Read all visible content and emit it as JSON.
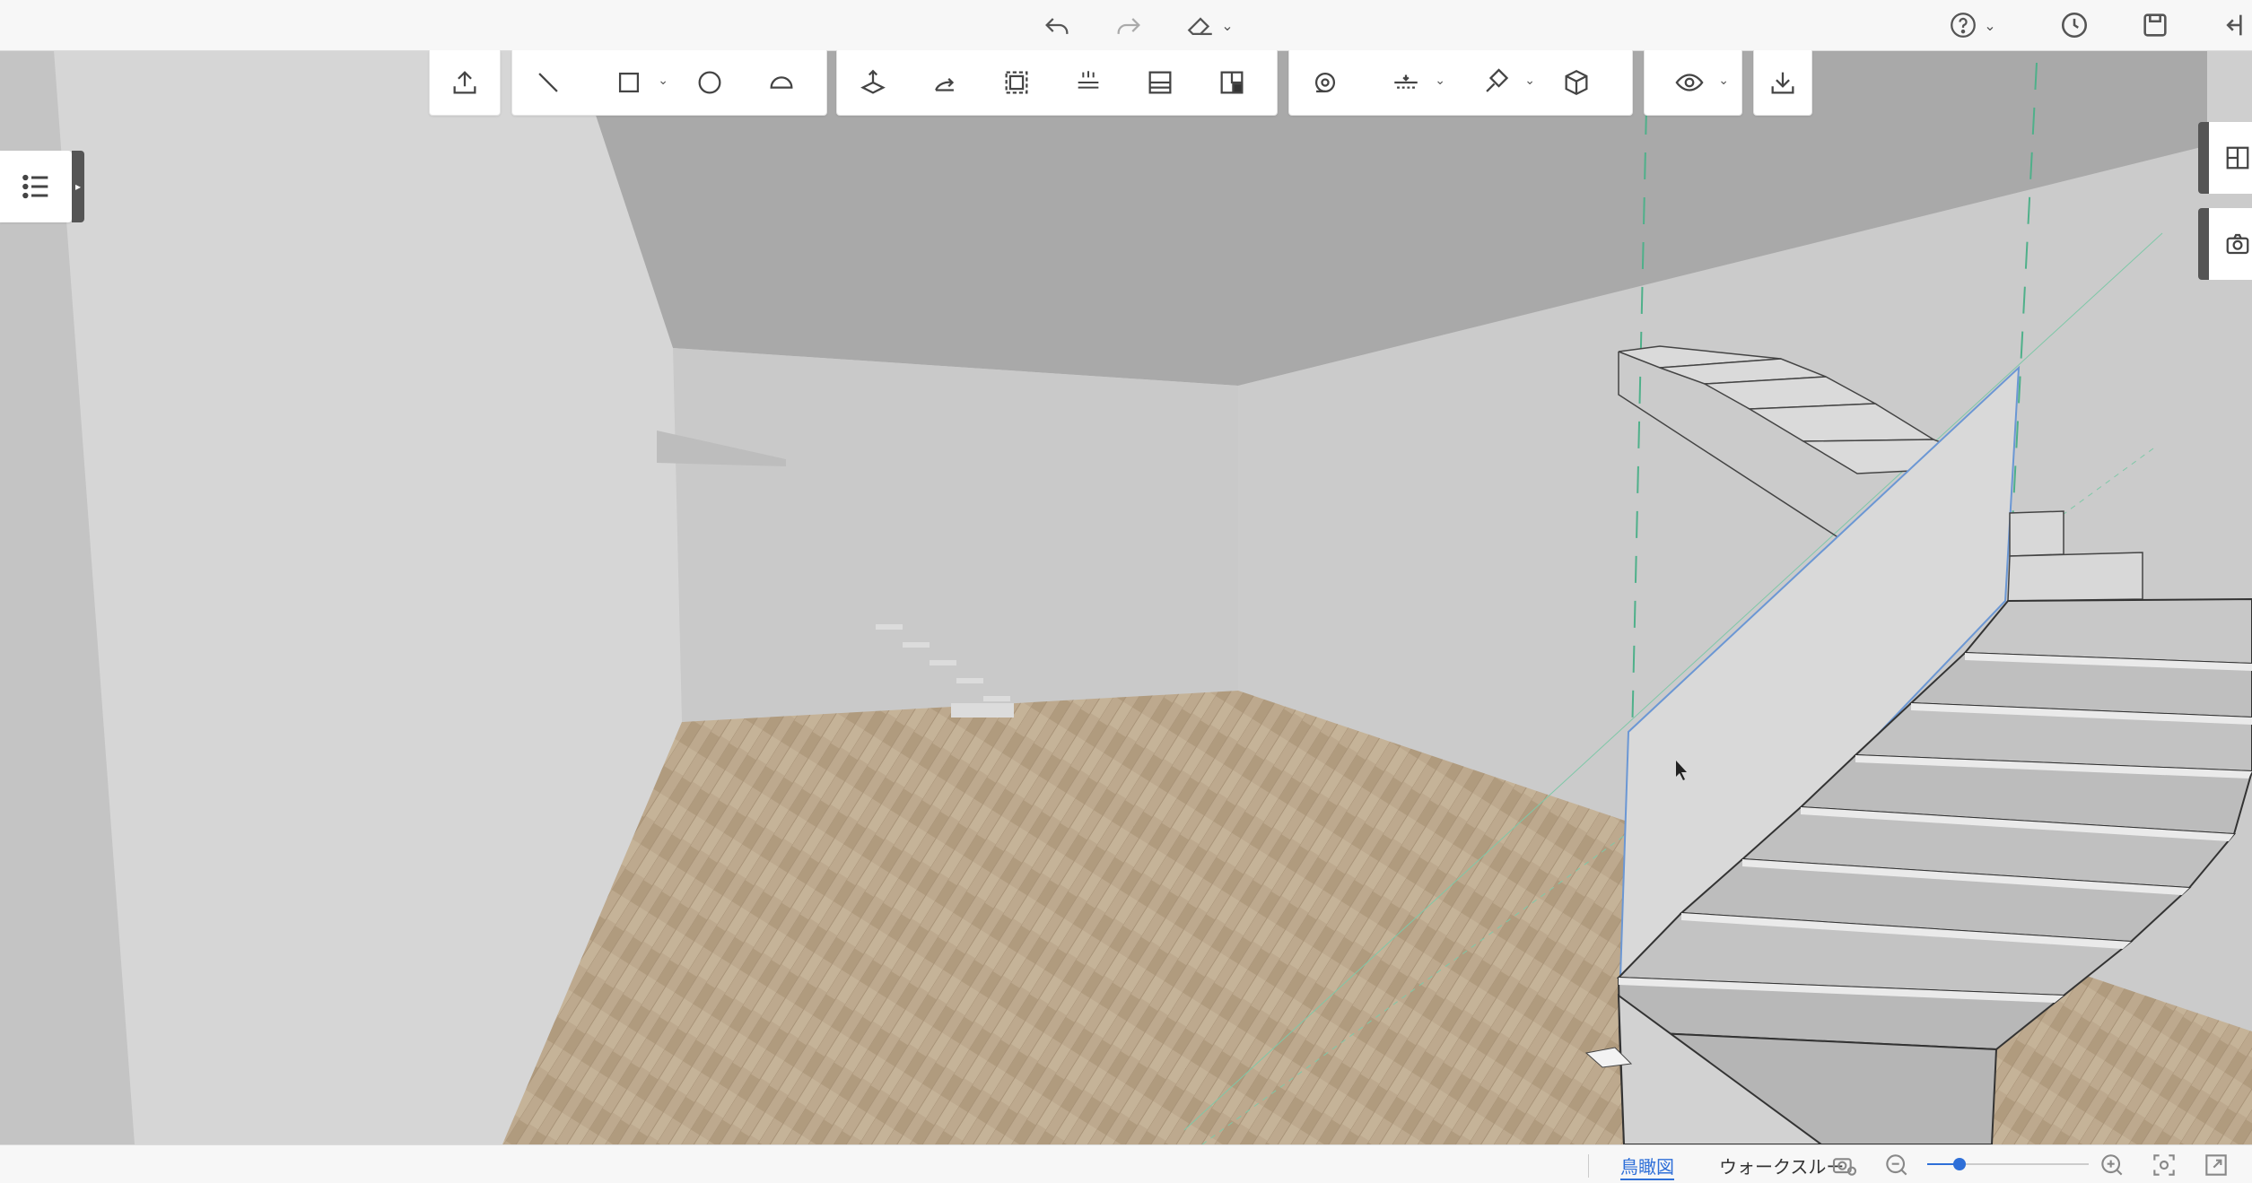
{
  "top_bar": {
    "undo_icon": "undo-icon",
    "redo_icon": "redo-icon",
    "eraser_icon": "eraser-icon",
    "help_icon": "help-icon",
    "history_icon": "clock-icon",
    "save_icon": "save-icon",
    "exit_icon": "exit-icon"
  },
  "toolbar": {
    "groups": [
      [
        "upload-icon"
      ],
      [
        "line-icon",
        "rectangle-icon",
        "circle-icon",
        "arc-icon"
      ],
      [
        "push-pull-icon",
        "rotate-icon",
        "select-area-icon",
        "grid-icon",
        "floor-plan-icon",
        "material-icon"
      ],
      [
        "tape-measure-icon",
        "section-icon",
        "paint-icon",
        "box-icon"
      ],
      [
        "eye-icon"
      ],
      [
        "download-icon"
      ]
    ]
  },
  "bottom_bar": {
    "view_tabs": [
      "鳥瞰図",
      "ウォークスルー"
    ],
    "active_view": "鳥瞰図",
    "zoom_level": 0.2
  },
  "colors": {
    "accent": "#2e6fd8",
    "floor": "#b9a58a",
    "wall": "#d4d4d4",
    "ceiling": "#aaaaaa"
  }
}
